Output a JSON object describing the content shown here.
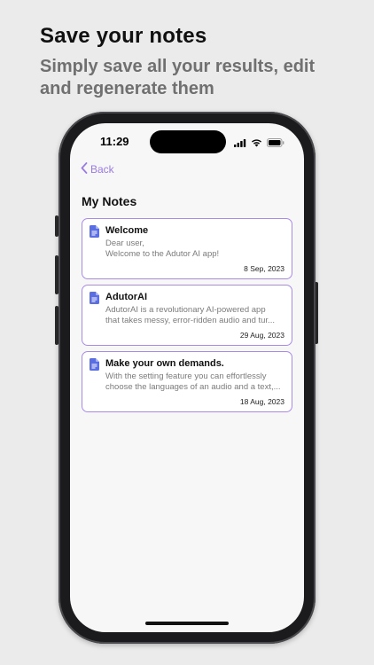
{
  "promo": {
    "title": "Save your notes",
    "subtitle": "Simply save all your results, edit and regenerate them"
  },
  "status_bar": {
    "time": "11:29",
    "icons": [
      "signal-icon",
      "wifi-icon",
      "battery-icon"
    ]
  },
  "nav": {
    "back_label": "Back",
    "back_icon": "chevron-left-icon"
  },
  "page": {
    "title": "My Notes"
  },
  "notes": [
    {
      "title": "Welcome",
      "line1": "Dear user,",
      "line2": "Welcome to the Adutor AI app!",
      "date": "8 Sep, 2023",
      "icon": "document-icon"
    },
    {
      "title": "AdutorAI",
      "line1": "AdutorAI is a revolutionary AI-powered app",
      "line2": "that takes messy, error-ridden audio and tur...",
      "date": "29 Aug, 2023",
      "icon": "document-icon"
    },
    {
      "title": "Make your own demands.",
      "line1": "With the setting feature you can effortlessly",
      "line2": "choose the languages of an audio and a text,...",
      "date": "18 Aug, 2023",
      "icon": "document-icon"
    }
  ],
  "colors": {
    "accent": "#9a7be0",
    "card_border": "#a98be6",
    "icon_blue": "#5b6ee1",
    "background": "#ebebeb",
    "screen": "#f7f7f7"
  }
}
